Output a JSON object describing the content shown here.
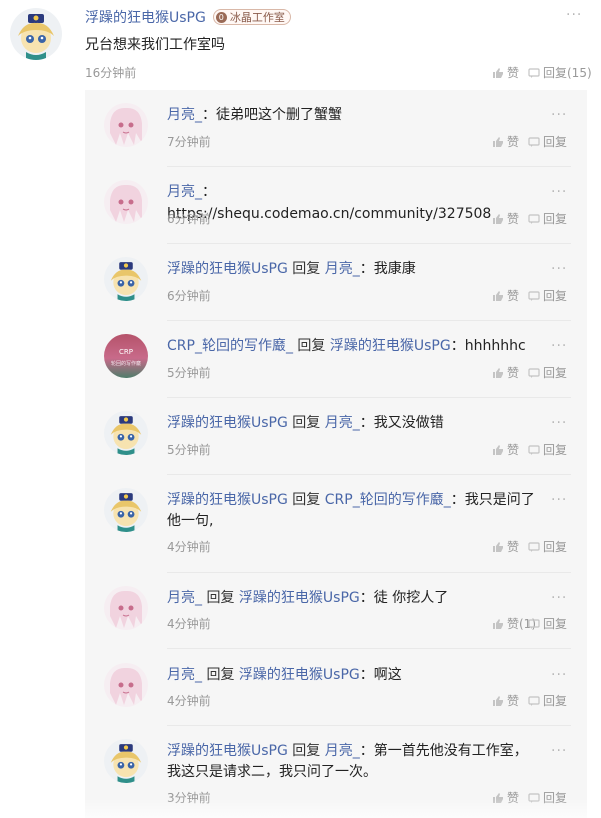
{
  "comment": {
    "author": "浮躁的狂电猴UsPG",
    "badge_text": "冰晶工作室",
    "badge_mark": "0",
    "text": "兄台想来我们工作室吗",
    "time": "16分钟前",
    "more": "···",
    "like_label": "赞",
    "reply_label": "回复(15)"
  },
  "replies": [
    {
      "author": "月亮_",
      "reply_word": "",
      "target": "",
      "sep": "：",
      "text": "徒弟吧这个删了蟹蟹",
      "text2": "",
      "time": "7分钟前",
      "like": "赞",
      "reply": "回复",
      "more": "···"
    },
    {
      "author": "月亮_",
      "reply_word": "",
      "target": "",
      "sep": "：",
      "text": "https://shequ.codemao.cn/community/327508",
      "text2": "",
      "time": "6分钟前",
      "like": "赞",
      "reply": "回复",
      "more": "···"
    },
    {
      "author": "浮躁的狂电猴UsPG",
      "reply_word": " 回复 ",
      "target": "月亮_",
      "sep": "：",
      "text": "我康康",
      "text2": "",
      "time": "6分钟前",
      "like": "赞",
      "reply": "回复",
      "more": "···"
    },
    {
      "author": "CRP_轮回的写作黀_",
      "reply_word": " 回复 ",
      "target": "浮躁的狂电猴UsPG",
      "sep": "：",
      "text": "hhhhhhc",
      "text2": "",
      "time": "5分钟前",
      "like": "赞",
      "reply": "回复",
      "more": "···"
    },
    {
      "author": "浮躁的狂电猴UsPG",
      "reply_word": " 回复 ",
      "target": "月亮_",
      "sep": "：",
      "text": "我又没做错",
      "text2": "",
      "time": "5分钟前",
      "like": "赞",
      "reply": "回复",
      "more": "···"
    },
    {
      "author": "浮躁的狂电猴UsPG",
      "reply_word": " 回复 ",
      "target": "CRP_轮回的写作黀_",
      "sep": "：",
      "text": "我只是问了",
      "text2": "他一句,",
      "time": "4分钟前",
      "like": "赞",
      "reply": "回复",
      "more": "···"
    },
    {
      "author": "月亮_",
      "reply_word": " 回复 ",
      "target": "浮躁的狂电猴UsPG",
      "sep": "：",
      "text": "徒 你挖人了",
      "text2": "",
      "time": "4分钟前",
      "like": "赞(1)",
      "reply": "回复",
      "more": "···"
    },
    {
      "author": "月亮_",
      "reply_word": " 回复 ",
      "target": "浮躁的狂电猴UsPG",
      "sep": "：",
      "text": "啊这",
      "text2": "",
      "time": "4分钟前",
      "like": "赞",
      "reply": "回复",
      "more": "···"
    },
    {
      "author": "浮躁的狂电猴UsPG",
      "reply_word": " 回复 ",
      "target": "月亮_",
      "sep": "：",
      "text": "第一首先他没有工作室，",
      "text2": "我这只是请求二，我只问了一次。",
      "time": "3分钟前",
      "like": "赞",
      "reply": "回复",
      "more": "···"
    }
  ],
  "crp_avatar_text": "CRP",
  "crp_avatar_sub": "轮回的写作黀",
  "colors": {
    "link": "#4a67a8",
    "muted": "#999999",
    "panel": "#f6f6f6"
  },
  "icons": {
    "like": "thumbs-up-icon",
    "reply": "comment-icon",
    "more": "more-dots-icon"
  }
}
